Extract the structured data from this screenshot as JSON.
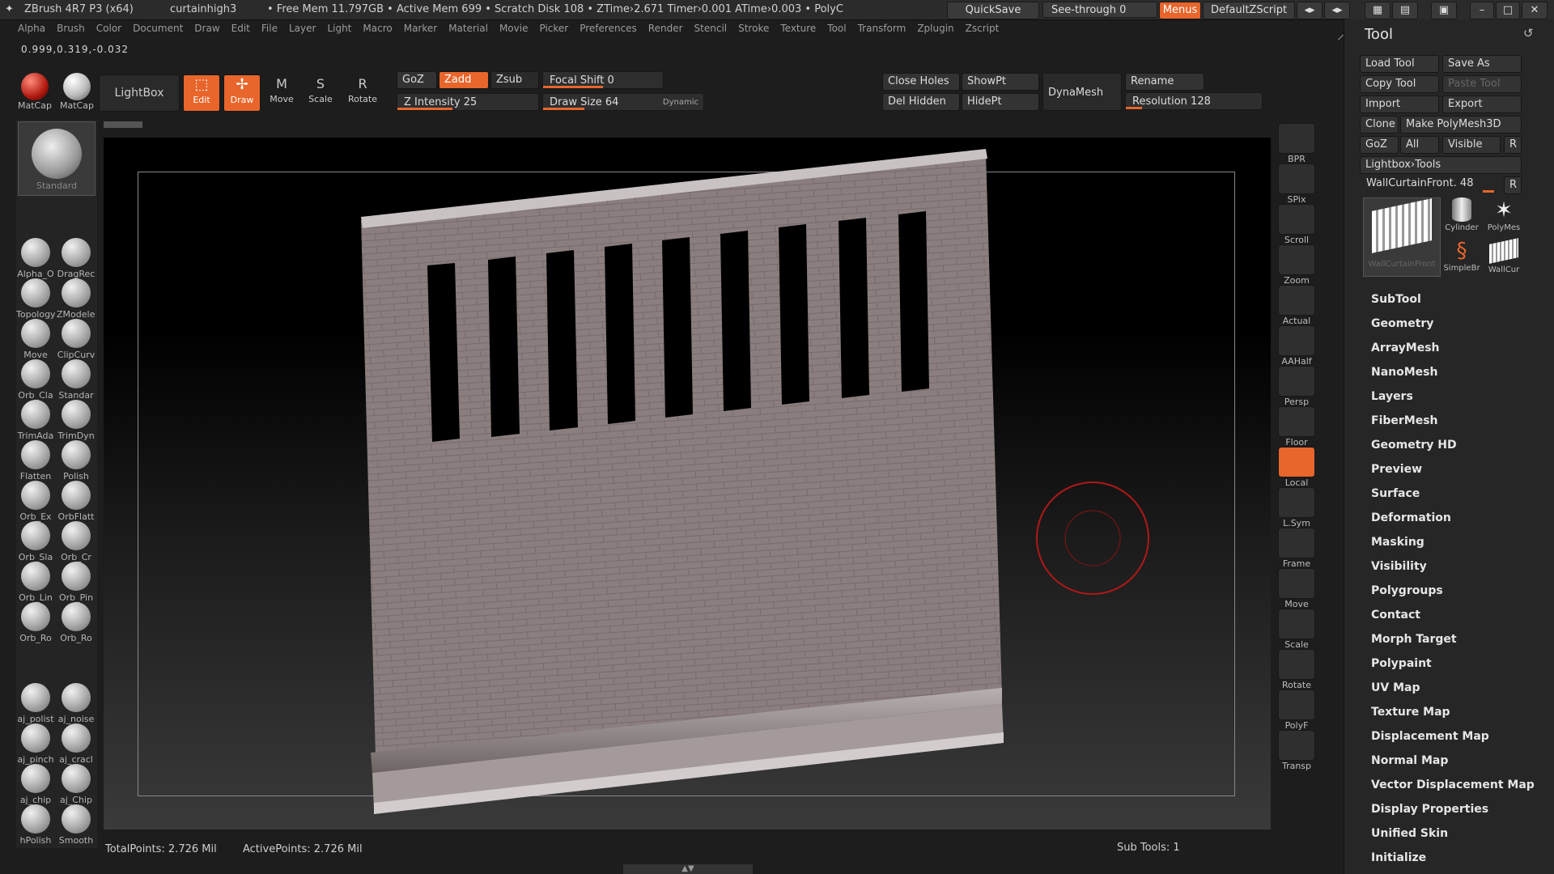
{
  "titlebar": {
    "app": "ZBrush 4R7 P3 (x64)",
    "doc": "curtainhigh3",
    "stats": "• Free Mem 11.797GB • Active Mem 699 • Scratch Disk 108 • ZTime›2.671 Timer›0.001 ATime›0.003 • PolyC",
    "quicksave": "QuickSave",
    "seethrough": "See-through   0",
    "menus": "Menus",
    "script": "DefaultZScript"
  },
  "menubar": [
    "Alpha",
    "Brush",
    "Color",
    "Document",
    "Draw",
    "Edit",
    "File",
    "Layer",
    "Light",
    "Macro",
    "Marker",
    "Material",
    "Movie",
    "Picker",
    "Preferences",
    "Render",
    "Stencil",
    "Stroke",
    "Texture",
    "Tool",
    "Transform",
    "Zplugin",
    "Zscript"
  ],
  "coords": "0.999,0.319,-0.032",
  "shelf": {
    "matcap1": "MatCap",
    "matcap2": "MatCap",
    "lightbox": "LightBox",
    "edit": "Edit",
    "draw": "Draw",
    "move": "Move",
    "scale": "Scale",
    "rotate": "Rotate",
    "goz": "GoZ",
    "zadd": "Zadd",
    "zsub": "Zsub",
    "focal_shift": "Focal Shift 0",
    "z_intensity": "Z Intensity 25",
    "draw_size": "Draw Size 64",
    "dynamic": "Dynamic",
    "close_holes": "Close Holes",
    "showpt": "ShowPt",
    "del_hidden": "Del Hidden",
    "hidept": "HidePt",
    "dynamesh": "DynaMesh",
    "rename": "Rename",
    "resolution": "Resolution 128"
  },
  "left_tools": [
    {
      "a": "Standard"
    },
    {
      "a": "Alpha_O",
      "b": "DragRec"
    },
    {
      "a": "Topology",
      "b": "ZModeler"
    },
    {
      "a": "Move",
      "b": "ClipCurv"
    },
    {
      "a": "Orb_Cla",
      "b": "Standar"
    },
    {
      "a": "TrimAda",
      "b": "TrimDyn"
    },
    {
      "a": "Flatten",
      "b": "Polish"
    },
    {
      "a": "Orb_Ex",
      "b": "OrbFlatt"
    },
    {
      "a": "Orb_Sla",
      "b": "Orb_Cr"
    },
    {
      "a": "Orb_Lin",
      "b": "Orb_Pin"
    },
    {
      "a": "Orb_Ro",
      "b": "Orb_Ro"
    },
    {
      "a": "aj_polist",
      "b": "aj_noise"
    },
    {
      "a": "aj_pinch",
      "b": "aj_cracl"
    },
    {
      "a": "aj_chip",
      "b": "aj_Chip"
    },
    {
      "a": "hPolish",
      "b": "Smooth"
    }
  ],
  "right_strip": [
    "BPR",
    "SPix",
    "Scroll",
    "Zoom",
    "Actual",
    "AAHalf",
    "Persp",
    "Floor",
    "Local",
    "L.Sym",
    "Frame",
    "Move",
    "Scale",
    "Rotate",
    "PolyF",
    "Transp"
  ],
  "tool_panel": {
    "title": "Tool",
    "load_tool": "Load Tool",
    "save_as": "Save As",
    "copy_tool": "Copy Tool",
    "paste_tool": "Paste Tool",
    "import": "Import",
    "export": "Export",
    "clone": "Clone",
    "make_polymesh": "Make PolyMesh3D",
    "goz": "GoZ",
    "all": "All",
    "visible": "Visible",
    "r": "R",
    "lightbox_tools": "Lightbox›Tools",
    "current": "WallCurtainFront. 48",
    "thumbs": [
      "WallCurtainFront",
      "Cylinder",
      "PolyMes",
      "SimpleBr",
      "WallCur"
    ],
    "menu": [
      "SubTool",
      "Geometry",
      "ArrayMesh",
      "NanoMesh",
      "Layers",
      "FiberMesh",
      "Geometry HD",
      "Preview",
      "Surface",
      "Deformation",
      "Masking",
      "Visibility",
      "Polygroups",
      "Contact",
      "Morph Target",
      "Polypaint",
      "UV Map",
      "Texture Map",
      "Displacement Map",
      "Normal Map",
      "Vector Displacement Map",
      "Display Properties",
      "Unified Skin",
      "Initialize"
    ]
  },
  "status": {
    "total": "TotalPoints: 2.726 Mil",
    "active": "ActivePoints: 2.726 Mil",
    "subtools": "Sub Tools: 1"
  },
  "colors": {
    "accent": "#e8652b",
    "bg": "#1d1d1d",
    "panel": "#262626",
    "mesh": "#8a7e7e"
  }
}
